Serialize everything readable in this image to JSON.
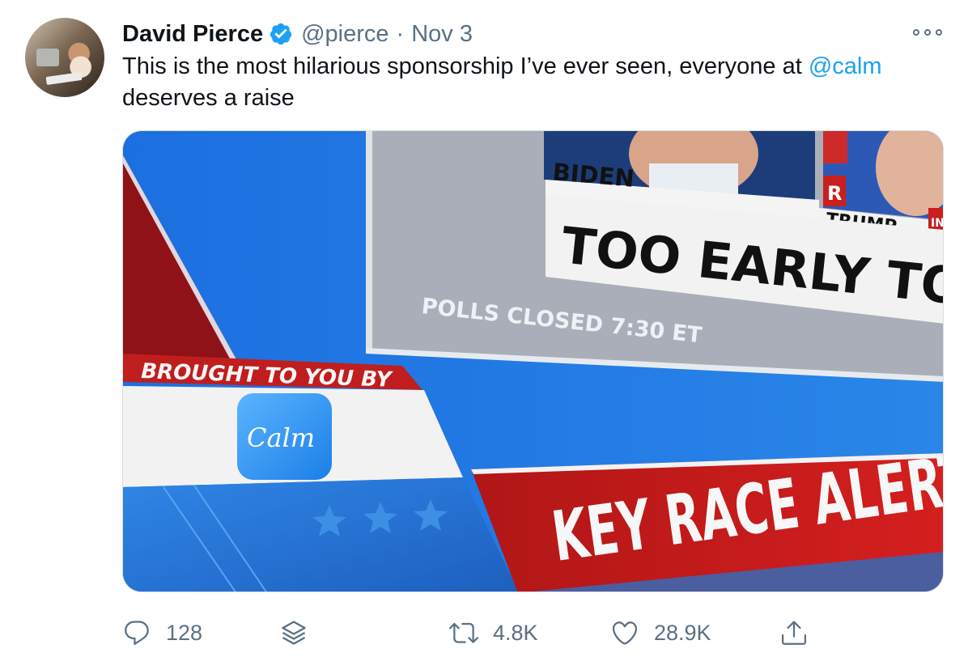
{
  "author": {
    "name": "David Pierce",
    "handle": "@pierce",
    "separator": "·",
    "date": "Nov 3"
  },
  "tweet": {
    "text_before": "This is the most hilarious sponsorship I’ve ever seen, everyone at ",
    "mention": "@calm",
    "text_after": " deserves a raise"
  },
  "media": {
    "label_biden": "BIDEN",
    "label_trump": "TRUMP",
    "party_r": "R",
    "party_in": "IN",
    "headline": "TOO EARLY TO CA",
    "polls": "POLLS CLOSED 7:30 ET",
    "brought": "BROUGHT TO YOU BY",
    "app": "Calm",
    "alert": "KEY RACE ALERT"
  },
  "stats": {
    "replies": "128",
    "retweets": "4.8K",
    "likes": "28.9K"
  },
  "colors": {
    "link": "#1da1f2",
    "muted": "#5b7083",
    "verified": "#1da1f2"
  },
  "icons": [
    "verified-icon",
    "more-icon",
    "reply-icon",
    "stack-icon",
    "retweet-icon",
    "like-icon",
    "share-icon"
  ]
}
